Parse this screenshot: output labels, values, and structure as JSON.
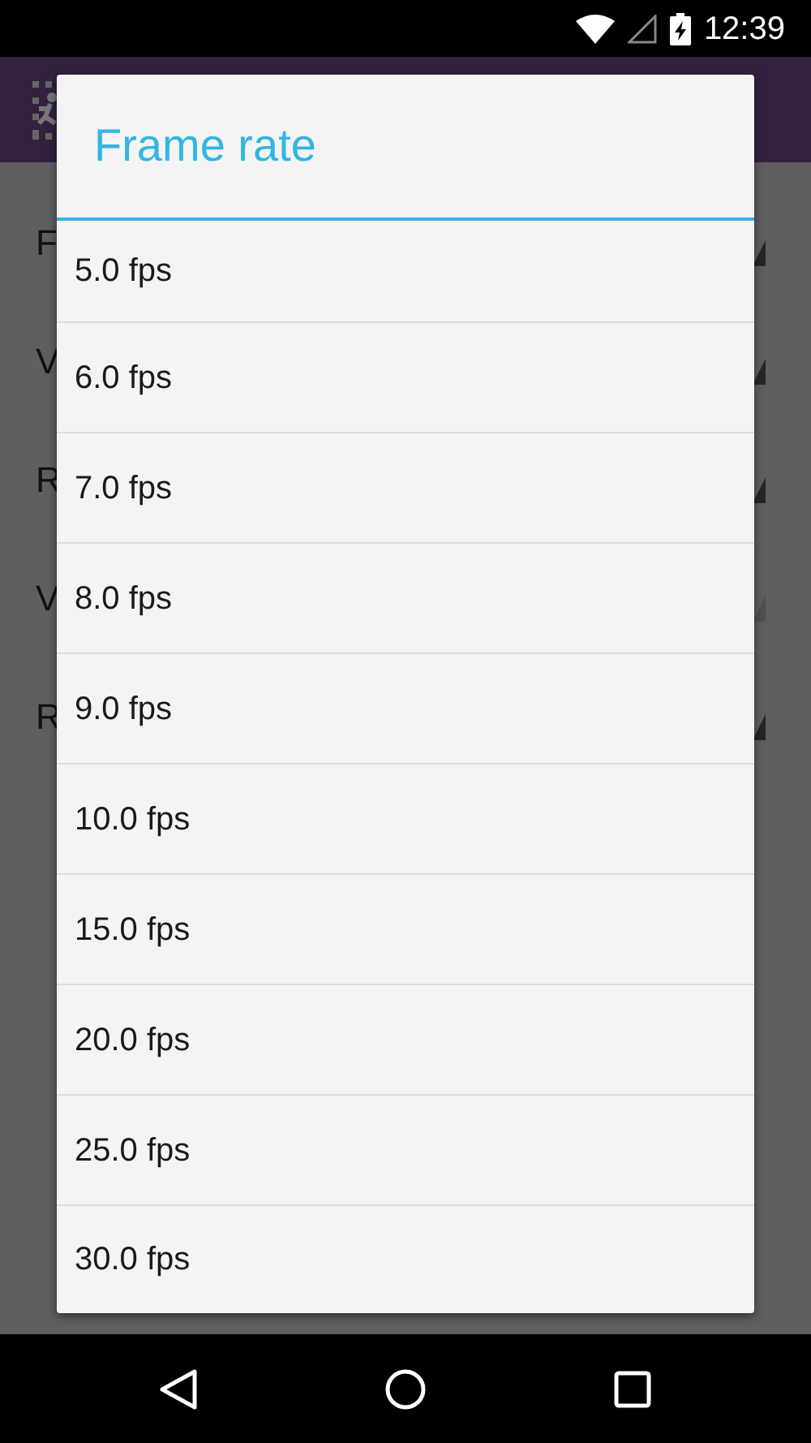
{
  "status_bar": {
    "time": "12:39"
  },
  "settings": [
    {
      "label": "F",
      "disabled": false
    },
    {
      "label": "V",
      "disabled": false
    },
    {
      "label": "R",
      "disabled": false
    },
    {
      "label": "V",
      "disabled": true
    },
    {
      "label": "R",
      "disabled": false
    }
  ],
  "dialog": {
    "title": "Frame rate",
    "options": [
      {
        "label": "5.0 fps"
      },
      {
        "label": "6.0 fps"
      },
      {
        "label": "7.0 fps"
      },
      {
        "label": "8.0 fps"
      },
      {
        "label": "9.0 fps"
      },
      {
        "label": "10.0 fps"
      },
      {
        "label": "15.0 fps"
      },
      {
        "label": "20.0 fps"
      },
      {
        "label": "25.0 fps"
      },
      {
        "label": "30.0 fps"
      }
    ]
  }
}
